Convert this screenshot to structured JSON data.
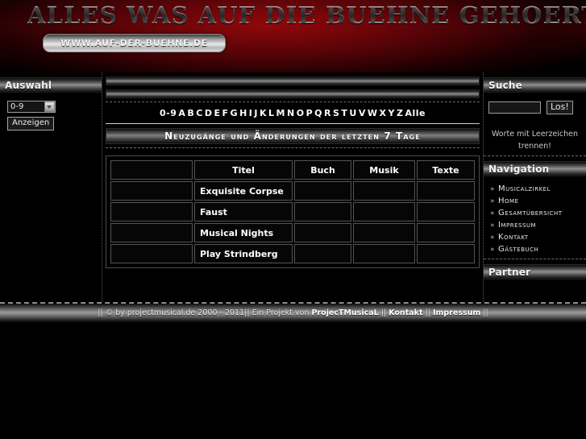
{
  "banner": {
    "title": "ALLES WAS AUF DIE BUEHNE GEHOERT",
    "url_badge": "WWW.AUF-DER-BUEHNE.DE"
  },
  "sidebar_left": {
    "header": "Auswahl",
    "select_value": "0-9",
    "submit_label": "Anzeigen"
  },
  "main": {
    "alpha_nav": [
      "0-9",
      "A",
      "B",
      "C",
      "D",
      "E",
      "F",
      "G",
      "H",
      "I",
      "J",
      "K",
      "L",
      "M",
      "N",
      "O",
      "P",
      "Q",
      "R",
      "S",
      "T",
      "U",
      "V",
      "W",
      "X",
      "Y",
      "Z",
      "Alle"
    ],
    "section_title": "Neuzugänge und Änderungen der letzten 7 Tage",
    "table": {
      "headers": [
        "",
        "Titel",
        "Buch",
        "Musik",
        "Texte"
      ],
      "rows": [
        [
          "",
          "Exquisite Corpse",
          "",
          "",
          ""
        ],
        [
          "",
          "Faust",
          "",
          "",
          ""
        ],
        [
          "",
          "Musical Nights",
          "",
          "",
          ""
        ],
        [
          "",
          "Play Strindberg",
          "",
          "",
          ""
        ]
      ]
    }
  },
  "sidebar_right": {
    "search_header": "Suche",
    "search_value": "",
    "search_button": "Los!",
    "search_hint_line1": "Worte mit Leerzeichen",
    "search_hint_line2": "trennen!",
    "nav_header": "Navigation",
    "nav_items": [
      "Musicalzirkel",
      "Home",
      "Gesamtübersicht",
      "Impressum",
      "Kontakt",
      "Gästebuch"
    ],
    "nav_bullet": "»",
    "partner_header": "Partner"
  },
  "footer": {
    "prefix": "|| © by projectmusical.de 2000 - 2011|| Ein Projekt von ",
    "brand": "ProjecTMusicaL",
    "sep1": " || ",
    "kontakt": "Kontakt",
    "sep2": " || ",
    "impressum": "Impressum",
    "suffix": " ||"
  }
}
